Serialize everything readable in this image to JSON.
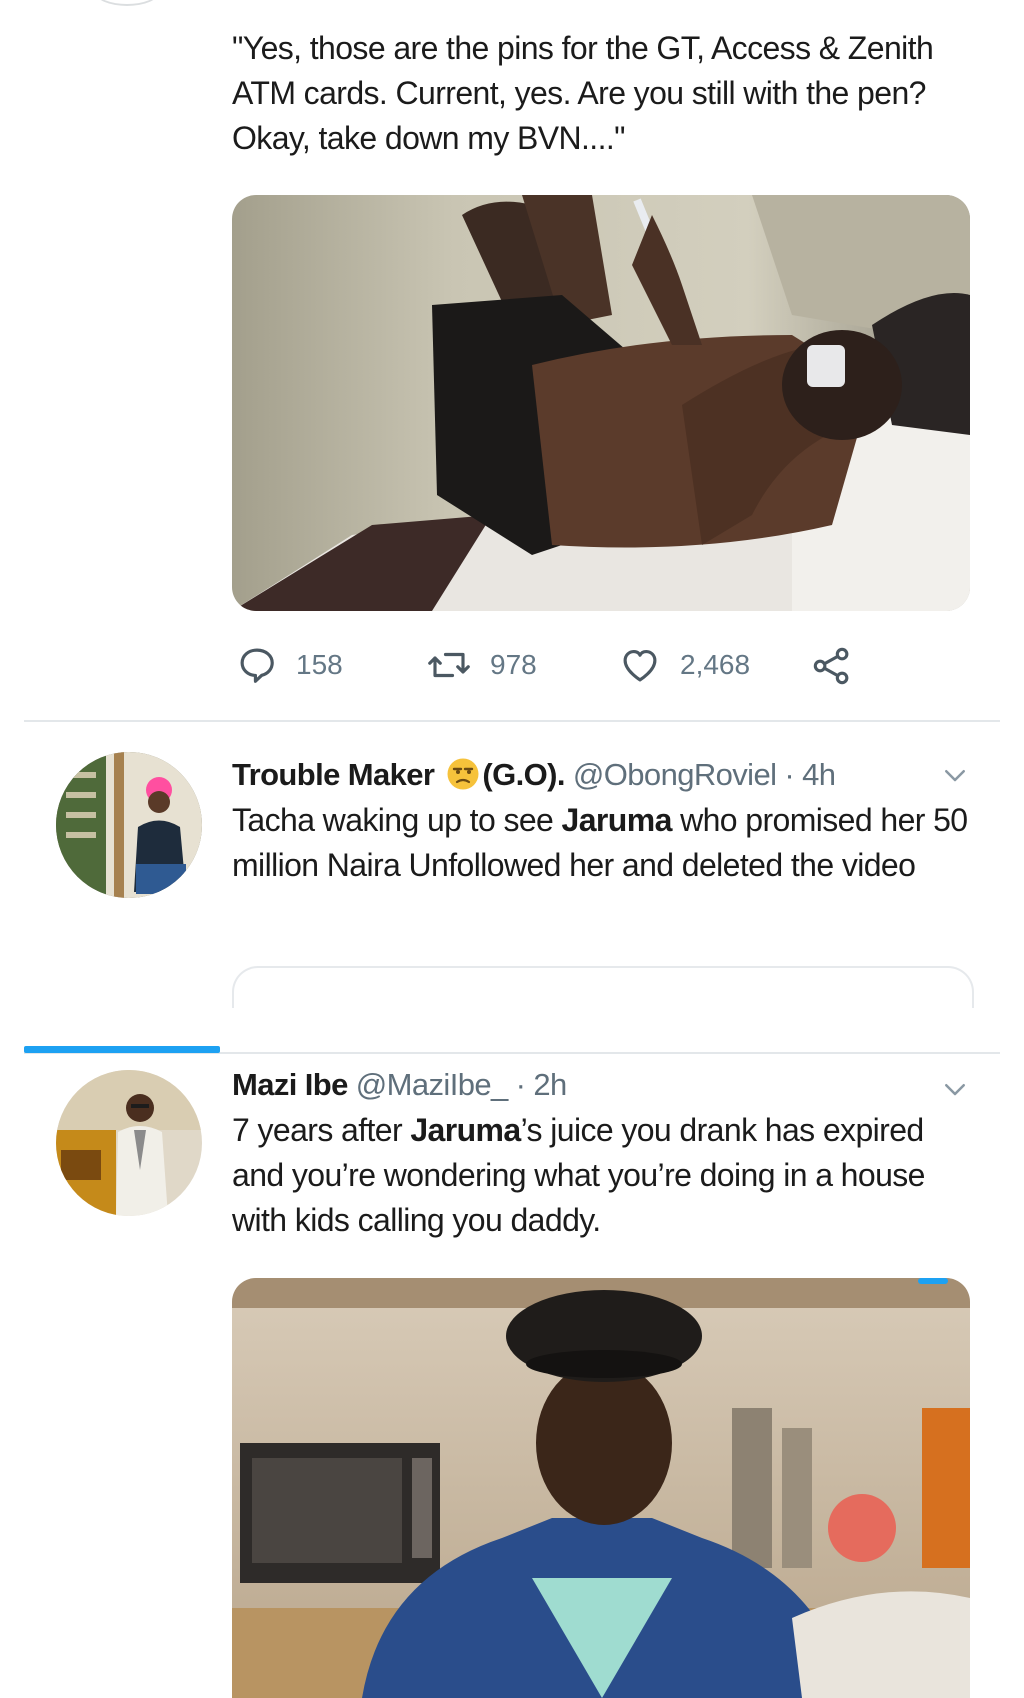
{
  "tweet1": {
    "text": "\"Yes, those are the pins for the GT, Access & Zenith ATM cards. Current, yes. Are you still with the pen? Okay, take down my BVN....\"",
    "replies": "158",
    "retweets": "978",
    "likes": "2,468"
  },
  "tweet2": {
    "name": "Trouble Maker",
    "name_suffix": "(G.O).",
    "emoji": "unamused-face-icon",
    "handle": "@ObongRoviel",
    "time": "· 4h",
    "text_parts": [
      "Tacha waking up to see ",
      "Jaruma",
      " who promised her 50 million Naira Unfollowed her and deleted the video"
    ]
  },
  "tweet3": {
    "name": "Mazi Ibe",
    "handle": "@MaziIbe_",
    "time": "· 2h",
    "text_parts": [
      "7 years after ",
      "Jaruma",
      "’s juice you drank has expired and you’re wondering what you’re doing in a house with kids calling you daddy."
    ]
  },
  "colors": {
    "accent": "#1da1f2",
    "divider": "#e3e7ea",
    "muted": "#647785"
  }
}
